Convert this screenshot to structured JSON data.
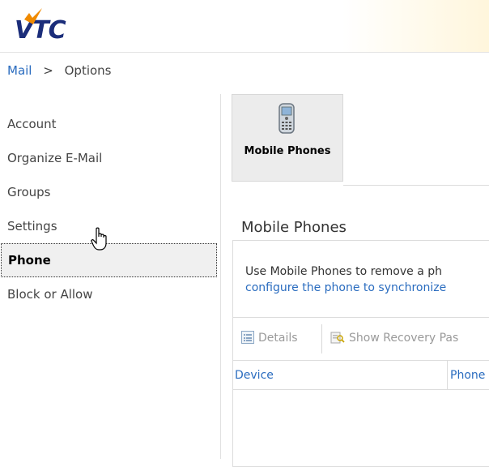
{
  "brand": {
    "logo_text": "VTC"
  },
  "breadcrumb": {
    "root": "Mail",
    "separator": ">",
    "current": "Options"
  },
  "nav": {
    "items": [
      {
        "label": "Account"
      },
      {
        "label": "Organize E-Mail"
      },
      {
        "label": "Groups"
      },
      {
        "label": "Settings"
      },
      {
        "label": "Phone",
        "selected": true
      },
      {
        "label": "Block or Allow"
      }
    ]
  },
  "tile": {
    "label": "Mobile Phones",
    "icon": "mobile-phone-icon"
  },
  "section": {
    "title": "Mobile Phones",
    "description_line1": "Use Mobile Phones to remove a ph",
    "description_line2": "configure the phone to synchronize"
  },
  "toolbar": {
    "details_label": "Details",
    "recovery_label": "Show Recovery Pas"
  },
  "table": {
    "columns": [
      "Device",
      "Phone"
    ]
  },
  "colors": {
    "link": "#2a6cbf",
    "brand": "#1b2d7a",
    "accent_orange": "#f08a00"
  }
}
